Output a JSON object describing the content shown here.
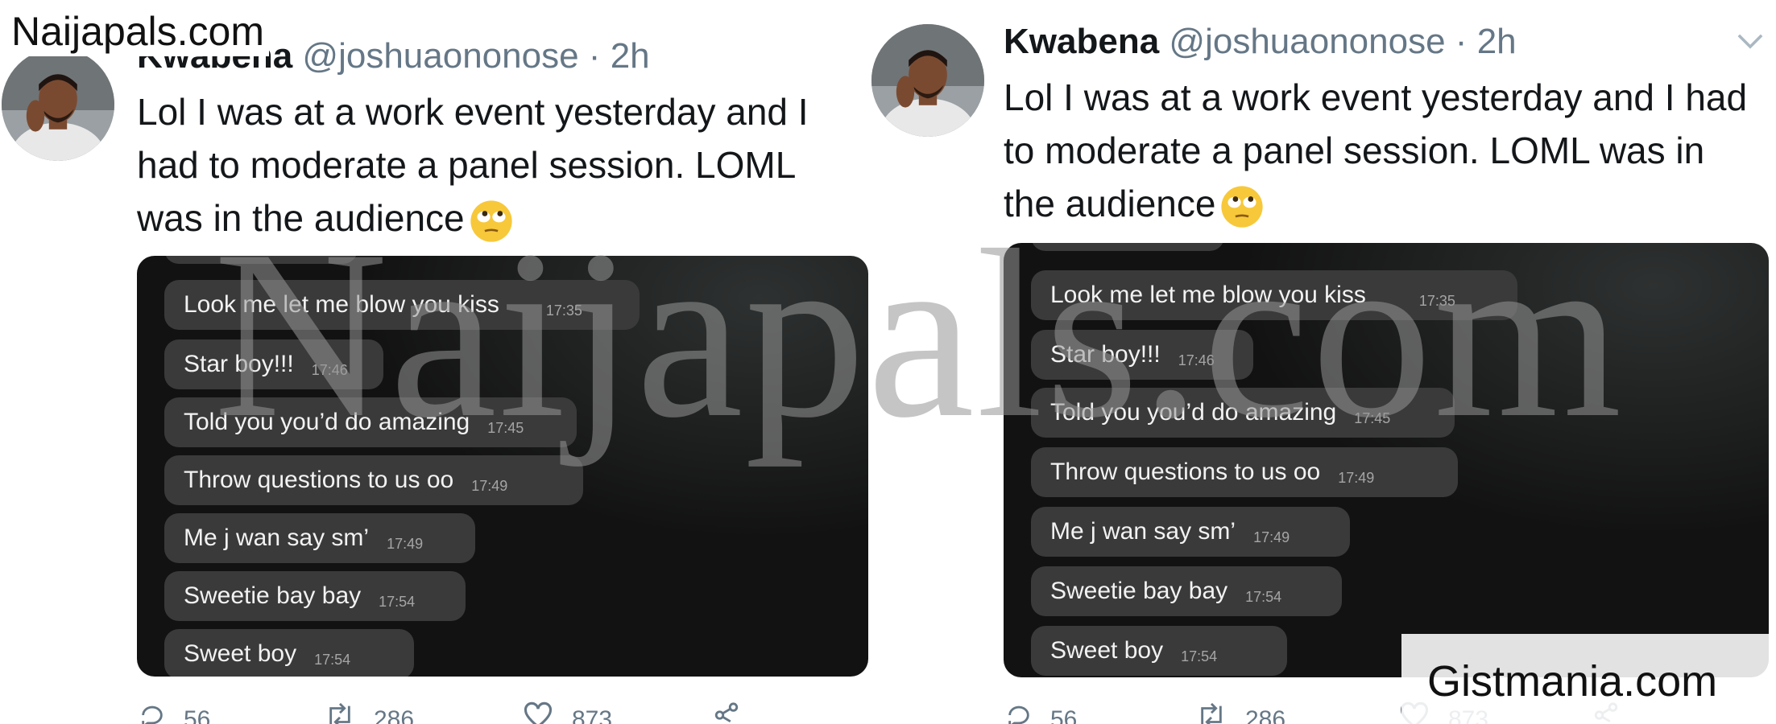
{
  "site_label_left": "Naijapals.com",
  "site_label_right": "Gistmania.com",
  "watermark": "Naijapals.com",
  "tweet": {
    "name": "Kwabena",
    "handle": "@joshuaononose",
    "separator": "·",
    "age": "2h",
    "text": "Lol I was at a work event yesterday and I had to moderate a panel session. LOML was in the audience",
    "emoji": "face-with-rolling-eyes-icon"
  },
  "messages": [
    {
      "text": "Look me let me blow you kiss",
      "time": "17:35"
    },
    {
      "text": "Star boy!!!",
      "time": "17:46"
    },
    {
      "text": "Told you you’d do amazing",
      "time": "17:45"
    },
    {
      "text": "Throw questions to us oo",
      "time": "17:49"
    },
    {
      "text": "Me j wan say sm’",
      "time": "17:49"
    },
    {
      "text": "Sweetie bay bay",
      "time": "17:54"
    },
    {
      "text": "Sweet boy",
      "time": "17:54"
    }
  ],
  "actions": {
    "reply_count": "56",
    "retweet_count": "286",
    "like_count": "873"
  },
  "colors": {
    "text": "#14171a",
    "secondary": "#657786",
    "chat_background": "#121212",
    "bubble": "#3a3a3a"
  }
}
